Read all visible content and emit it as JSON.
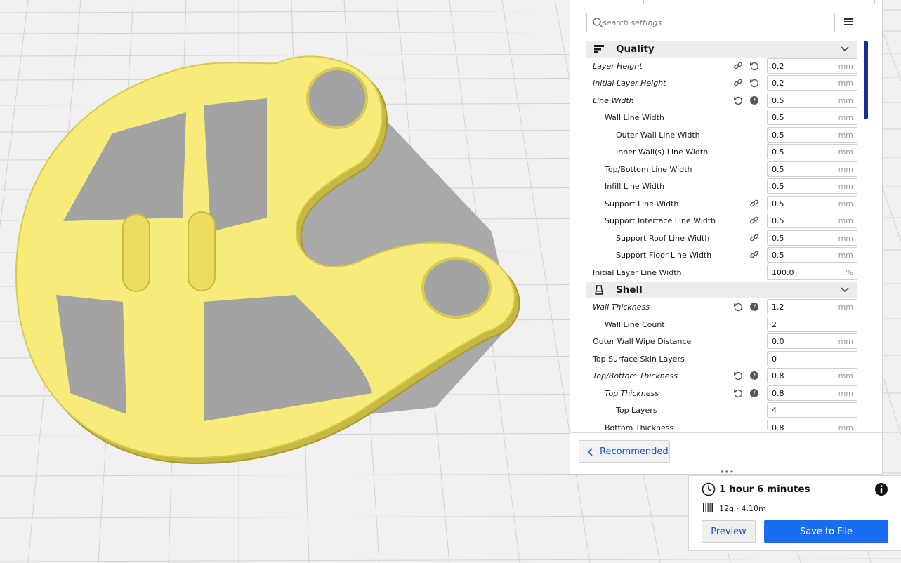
{
  "colors": {
    "accent": "#196ef0",
    "link": "#1d4fcf",
    "model": "#f7ec7a",
    "scrollbar": "#1a2c8c"
  },
  "search": {
    "placeholder": "search settings"
  },
  "categories": [
    {
      "label": "Quality",
      "icon": "quality-bars-icon"
    },
    {
      "label": "Shell",
      "icon": "shell-icon"
    }
  ],
  "settings": [
    {
      "label": "Layer Height",
      "value": "0.2",
      "unit": "mm"
    },
    {
      "label": "Initial Layer Height",
      "value": "0.2",
      "unit": "mm"
    },
    {
      "label": "Line Width",
      "value": "0.5",
      "unit": "mm"
    },
    {
      "label": "Wall Line Width",
      "value": "0.5",
      "unit": "mm"
    },
    {
      "label": "Outer Wall Line Width",
      "value": "0.5",
      "unit": "mm"
    },
    {
      "label": "Inner Wall(s) Line Width",
      "value": "0.5",
      "unit": "mm"
    },
    {
      "label": "Top/Bottom Line Width",
      "value": "0.5",
      "unit": "mm"
    },
    {
      "label": "Infill Line Width",
      "value": "0.5",
      "unit": "mm"
    },
    {
      "label": "Support Line Width",
      "value": "0.5",
      "unit": "mm"
    },
    {
      "label": "Support Interface Line Width",
      "value": "0.5",
      "unit": "mm"
    },
    {
      "label": "Support Roof Line Width",
      "value": "0.5",
      "unit": "mm"
    },
    {
      "label": "Support Floor Line Width",
      "value": "0.5",
      "unit": "mm"
    },
    {
      "label": "Initial Layer Line Width",
      "value": "100.0",
      "unit": "%"
    },
    {
      "label": "Wall Thickness",
      "value": "1.2",
      "unit": "mm"
    },
    {
      "label": "Wall Line Count",
      "value": "2",
      "unit": ""
    },
    {
      "label": "Outer Wall Wipe Distance",
      "value": "0.0",
      "unit": "mm"
    },
    {
      "label": "Top Surface Skin Layers",
      "value": "0",
      "unit": ""
    },
    {
      "label": "Top/Bottom Thickness",
      "value": "0.8",
      "unit": "mm"
    },
    {
      "label": "Top Thickness",
      "value": "0.8",
      "unit": "mm"
    },
    {
      "label": "Top Layers",
      "value": "4",
      "unit": ""
    },
    {
      "label": "Bottom Thickness",
      "value": "0.8",
      "unit": "mm"
    }
  ],
  "footer": {
    "recommended_label": "Recommended"
  },
  "summary": {
    "print_time": "1 hour 6 minutes",
    "material": "12g · 4.10m",
    "preview_label": "Preview",
    "save_label": "Save to File"
  }
}
